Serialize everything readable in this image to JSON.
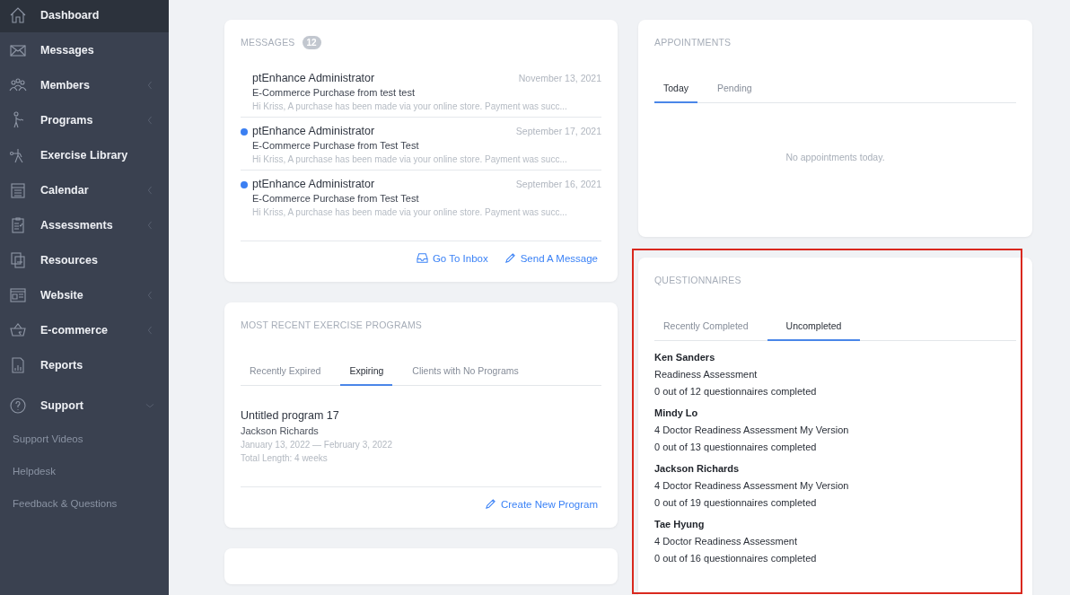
{
  "sidebar": {
    "items": [
      {
        "label": "Dashboard",
        "selected": true
      },
      {
        "label": "Messages",
        "selected": false
      },
      {
        "label": "Members",
        "selected": false,
        "expanded": false
      },
      {
        "label": "Programs",
        "selected": false,
        "expanded": false
      },
      {
        "label": "Exercise Library",
        "selected": false
      },
      {
        "label": "Calendar",
        "selected": false,
        "expanded": false
      },
      {
        "label": "Assessments",
        "selected": false,
        "expanded": false
      },
      {
        "label": "Resources",
        "selected": false
      },
      {
        "label": "Website",
        "selected": false,
        "expanded": false
      },
      {
        "label": "E-commerce",
        "selected": false,
        "expanded": false
      },
      {
        "label": "Reports",
        "selected": false
      },
      {
        "label": "Support",
        "selected": false,
        "expanded": true,
        "children": [
          {
            "label": "Support Videos"
          },
          {
            "label": "Helpdesk"
          },
          {
            "label": "Feedback & Questions"
          }
        ]
      }
    ]
  },
  "messages": {
    "title": "MESSAGES",
    "count": "12",
    "items": [
      {
        "sender": "ptEnhance Administrator",
        "date": "November 13, 2021",
        "subject": "E-Commerce Purchase from test test",
        "preview": "Hi Kriss, A purchase has been made via your online store. Payment was succ...",
        "unread": false
      },
      {
        "sender": "ptEnhance Administrator",
        "date": "September 17, 2021",
        "subject": "E-Commerce Purchase from Test Test",
        "preview": "Hi Kriss, A purchase has been made via your online store. Payment was succ...",
        "unread": true
      },
      {
        "sender": "ptEnhance Administrator",
        "date": "September 16, 2021",
        "subject": "E-Commerce Purchase from Test Test",
        "preview": "Hi Kriss, A purchase has been made via your online store. Payment was succ...",
        "unread": true
      }
    ],
    "actions": [
      "Go To Inbox",
      "Send A Message"
    ]
  },
  "programs": {
    "title": "MOST RECENT EXERCISE PROGRAMS",
    "tabs": [
      {
        "label": "Recently Expired",
        "selected": false
      },
      {
        "label": "Expiring",
        "selected": true
      },
      {
        "label": "Clients with No Programs",
        "selected": false
      }
    ],
    "items": [
      {
        "name": "Untitled program 17",
        "client": "Jackson Richards",
        "dates": "January 13, 2022 — February 3, 2022",
        "length": "Total Length: 4 weeks"
      }
    ],
    "action": "Create New Program"
  },
  "appointments": {
    "title": "APPOINTMENTS",
    "tabs": [
      {
        "label": "Today",
        "selected": true
      },
      {
        "label": "Pending",
        "selected": false
      }
    ],
    "empty_text": "No appointments today."
  },
  "questionnaires": {
    "title": "QUESTIONNAIRES",
    "highlighted": true,
    "tabs": [
      {
        "label": "Recently Completed",
        "selected": false
      },
      {
        "label": "Uncompleted",
        "selected": true
      }
    ],
    "items": [
      {
        "client": "Ken Sanders",
        "questionnaire": "Readiness Assessment",
        "progress": "0 out of 12 questionnaires completed"
      },
      {
        "client": "Mindy Lo",
        "questionnaire": "4 Doctor Readiness Assessment My Version",
        "progress": "0 out of 13 questionnaires completed"
      },
      {
        "client": "Jackson Richards",
        "questionnaire": "4 Doctor Readiness Assessment My Version",
        "progress": "0 out of 19 questionnaires completed"
      },
      {
        "client": "Tae Hyung",
        "questionnaire": "4 Doctor Readiness Assessment",
        "progress": "0 out of 16 questionnaires completed"
      }
    ]
  }
}
